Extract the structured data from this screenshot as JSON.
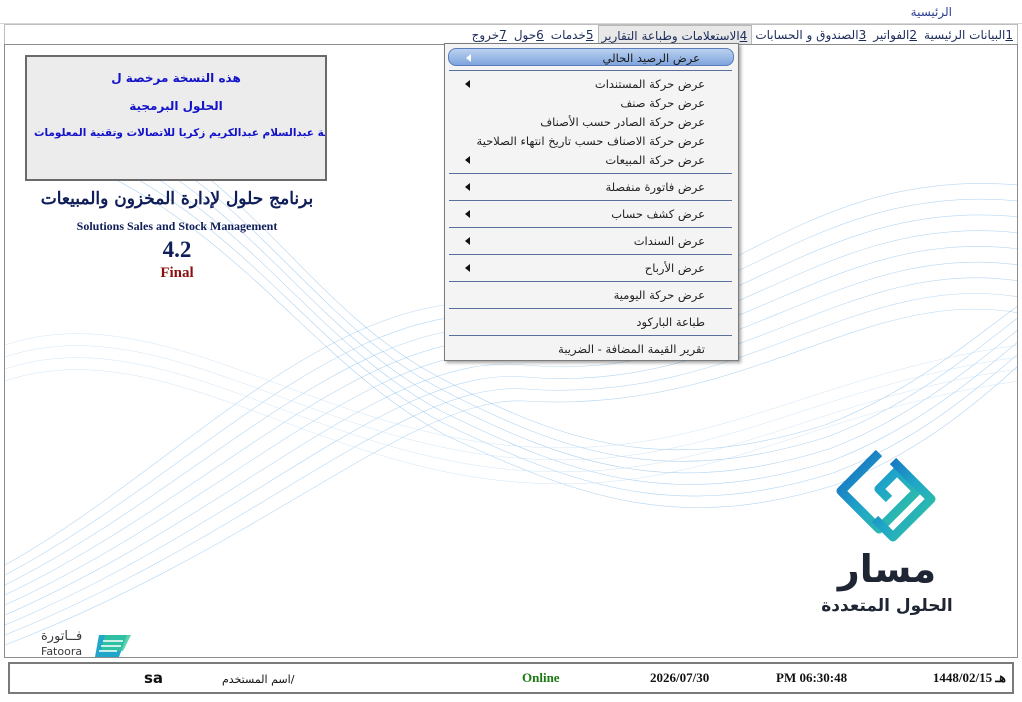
{
  "window": {
    "title": "الرئيسية"
  },
  "menubar": [
    {
      "key": "1",
      "label": "البيانات الرئيسية"
    },
    {
      "key": "2",
      "label": "الفواتير"
    },
    {
      "key": "3",
      "label": "الصندوق و الحسابات"
    },
    {
      "key": "4",
      "label": "الاستعلامات وطباعة التقارير"
    },
    {
      "key": "5",
      "label": "خدمات"
    },
    {
      "key": "6",
      "label": "حول"
    },
    {
      "key": "7",
      "label": "خروج"
    }
  ],
  "license": {
    "line1": "هذه النسخة مرخصة ل",
    "line2": "الحلول البرمجية",
    "line3": "مؤسسة عبدالسلام عبدالكريم زكريا للاتصالات وتقنية المعلومات"
  },
  "program": {
    "name_ar": "برنامج حلول لإدارة المخزون والمبيعات",
    "name_en": "Solutions Sales and Stock Management",
    "version": "4.2",
    "release": "Final"
  },
  "brand": {
    "name": "مسار",
    "subtitle": "الحلول المتعددة",
    "fatoora_ar": "فــاتورة",
    "fatoora_en": "Fatoora"
  },
  "dropdown": {
    "items": [
      {
        "label": "عرض الرصيد الحالي",
        "submenu": true,
        "highlighted": true
      },
      {
        "label": "عرض حركة المستندات",
        "submenu": true
      },
      {
        "label": "عرض حركة صنف",
        "submenu": false
      },
      {
        "label": "عرض حركة الصادر حسب الأصناف",
        "submenu": false
      },
      {
        "label": "عرض حركة الاصناف حسب تاريخ انتهاء الصلاحية",
        "submenu": false
      },
      {
        "label": "عرض حركة المبيعات",
        "submenu": true
      },
      {
        "label": "عرض فاتورة منفصلة",
        "submenu": true
      },
      {
        "label": "عرض كشف حساب",
        "submenu": true
      },
      {
        "label": "عرض السندات",
        "submenu": true
      },
      {
        "label": "عرض الأرباح",
        "submenu": true
      },
      {
        "label": "عرض حركة اليومية",
        "submenu": false
      },
      {
        "label": "طباعة الباركود",
        "submenu": false
      },
      {
        "label": "تقرير القيمة المضافة - الضريبة",
        "submenu": false
      }
    ]
  },
  "status": {
    "hijri_date": "1448/02/15 هـ",
    "time": "PM 06:30:48",
    "date": "2026/07/30",
    "connection": "Online",
    "user_label": "اسم المستخدم/",
    "user": "sa"
  },
  "colors": {
    "accent": "#5b7dbd",
    "brand_teal": "#1fa6c8",
    "online": "#1a7a12"
  }
}
